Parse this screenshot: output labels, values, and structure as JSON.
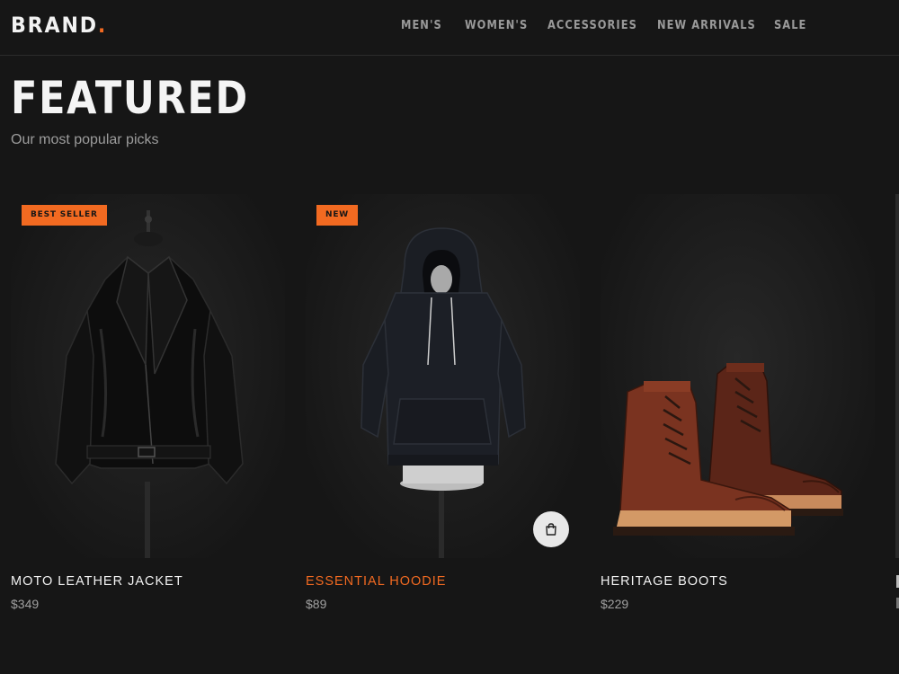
{
  "header": {
    "brand": "BRAND",
    "brand_dot": ".",
    "nav": [
      "MEN'S",
      "WOMEN'S",
      "ACCESSORIES",
      "NEW ARRIVALS",
      "SALE"
    ]
  },
  "hero": {
    "title": "FEATURED",
    "subtitle": "Our most popular picks"
  },
  "products": [
    {
      "name": "MOTO LEATHER JACKET",
      "price": "$349",
      "badge": "BEST SELLER"
    },
    {
      "name": "ESSENTIAL HOODIE",
      "price": "$89",
      "badge": "NEW"
    },
    {
      "name": "HERITAGE BOOTS",
      "price": "$229",
      "badge": ""
    }
  ],
  "colors": {
    "background": "#161616",
    "accent": "#f26a21",
    "text": "#f2f2f2",
    "muted": "#9c9c9c"
  },
  "icons": {
    "cart": "shopping-bag-icon"
  }
}
